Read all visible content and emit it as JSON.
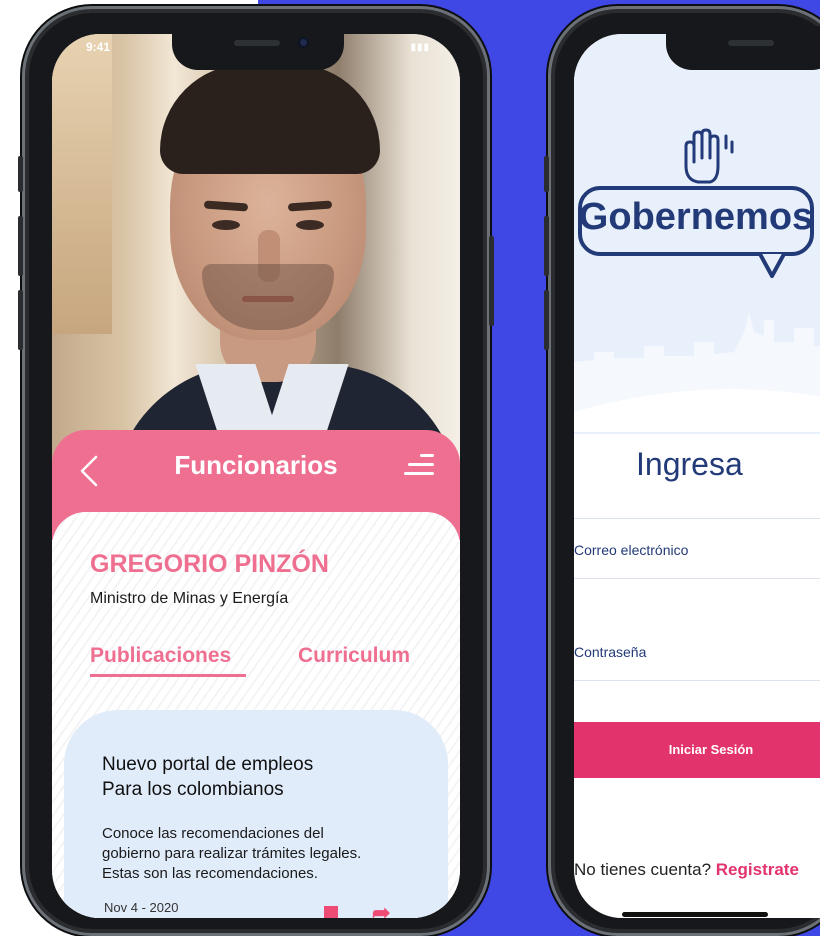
{
  "left_phone": {
    "status_time": "9:41",
    "nav": {
      "back_label": "‹",
      "title": "Funcionarios"
    },
    "profile": {
      "name": "GREGORIO PINZÓN",
      "role": "Ministro de Minas y Energía"
    },
    "tabs": [
      {
        "label": "Publicaciones",
        "active": true
      },
      {
        "label": "Curriculum",
        "active": false
      }
    ],
    "post": {
      "title_line1": "Nuevo portal de empleos",
      "title_line2": "Para los colombianos",
      "body_line1": "Conoce las recomendaciones del",
      "body_line2": "gobierno para realizar trámites legales.",
      "body_line3": "Estas son las recomendaciones.",
      "date": "Nov 4 - 2020"
    }
  },
  "right_phone": {
    "logo_text": "Gobernemos",
    "login_title": "Ingresa",
    "fields": {
      "email_label": "Correo electrónico",
      "password_label": "Contraseña"
    },
    "login_button": "Iniciar Sesión",
    "register_prompt": "No tienes cuenta?",
    "register_link": "Registrate"
  },
  "colors": {
    "accent_blue_bg": "#3f47e4",
    "pink": "#ef6f91",
    "cta_pink": "#e3336c",
    "navy": "#233a78",
    "post_bg": "#e1ecfb"
  },
  "icons": {
    "back": "chevron-left-icon",
    "menu": "menu-lines-icon",
    "bookmark": "bookmark-icon",
    "share": "share-arrow-icon",
    "logo_hand": "raised-hand-icon"
  }
}
